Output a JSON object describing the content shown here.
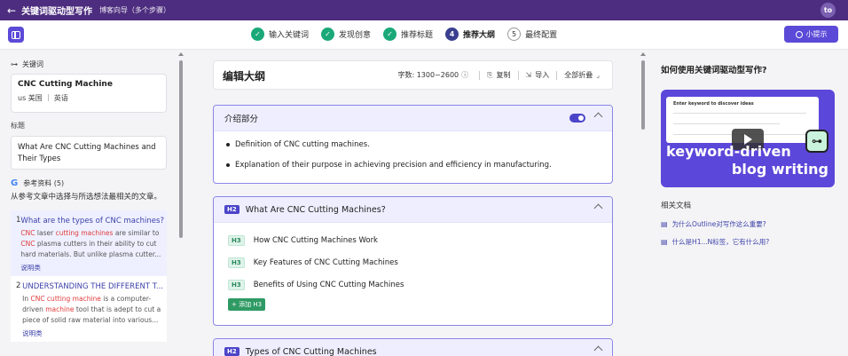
{
  "topbar": {
    "back_icon": "←",
    "title": "关键词驱动型写作",
    "subtitle": "博客向导（多个步骤）",
    "avatar": "to"
  },
  "steps": [
    {
      "num": "✓",
      "label": "输入关键词",
      "state": "done"
    },
    {
      "num": "✓",
      "label": "发现创意",
      "state": "done"
    },
    {
      "num": "✓",
      "label": "推荐标题",
      "state": "done"
    },
    {
      "num": "4",
      "label": "推荐大纲",
      "state": "current"
    },
    {
      "num": "5",
      "label": "最终配置",
      "state": "todo"
    }
  ],
  "tip_button": "小提示",
  "left": {
    "keyword_label": "关键词",
    "keyword": "CNC Cutting Machine",
    "locale": "us 美国 ｜ 英语",
    "title_label": "标题",
    "title_value": "What Are CNC Cutting Machines and Their Types",
    "refs_label": "参考资料 (5)",
    "refs_desc": "从参考文章中选择与所选想法最相关的文章。",
    "refs": [
      {
        "num": "1",
        "title": "What are the types of CNC machines?",
        "snippet_parts": [
          {
            "t": "CNC",
            "hl": true
          },
          {
            "t": " laser ",
            "hl": false
          },
          {
            "t": "cutting machines",
            "hl": true
          },
          {
            "t": " are similar to ",
            "hl": false
          },
          {
            "t": "CNC",
            "hl": true
          },
          {
            "t": " plasma cutters in their ability to cut hard materials. But unlike plasma cutter...",
            "hl": false
          }
        ],
        "category": "说明类"
      },
      {
        "num": "2",
        "title": "UNDERSTANDING THE DIFFERENT T...",
        "snippet_parts": [
          {
            "t": "In ",
            "hl": false
          },
          {
            "t": "CNC cutting machine",
            "hl": true
          },
          {
            "t": " is a computer-driven ",
            "hl": false
          },
          {
            "t": "machine",
            "hl": true
          },
          {
            "t": " tool that is adept to cut a piece of solid raw material into various...",
            "hl": false
          }
        ],
        "category": "说明类"
      }
    ]
  },
  "editor": {
    "heading": "编辑大纲",
    "word_count": "字数: 1300~2600",
    "copy": "复制",
    "import": "导入",
    "collapse": "全部折叠",
    "intro": {
      "title": "介绍部分",
      "bullets": [
        "Definition of CNC cutting machines.",
        "Explanation of their purpose in achieving precision and efficiency in manufacturing."
      ]
    },
    "sections": [
      {
        "tag": "H2",
        "title": "What Are CNC Cutting Machines?",
        "subs": [
          {
            "tag": "H3",
            "title": "How CNC Cutting Machines Work"
          },
          {
            "tag": "H3",
            "title": "Key Features of CNC Cutting Machines"
          },
          {
            "tag": "H3",
            "title": "Benefits of Using CNC Cutting Machines"
          }
        ],
        "add_label": "+ 添加 H3"
      },
      {
        "tag": "H2",
        "title": "Types of CNC Cutting Machines"
      }
    ]
  },
  "right": {
    "title": "如何使用关键词驱动型写作?",
    "video_screen_text": "Enter keyword to discover ideas",
    "video_line1": "keyword-driven",
    "video_line2": "blog writing",
    "docs_label": "相关文档",
    "docs": [
      "为什么Outline对写作这么重要?",
      "什么是H1...N标签，它有什么用?"
    ]
  }
}
